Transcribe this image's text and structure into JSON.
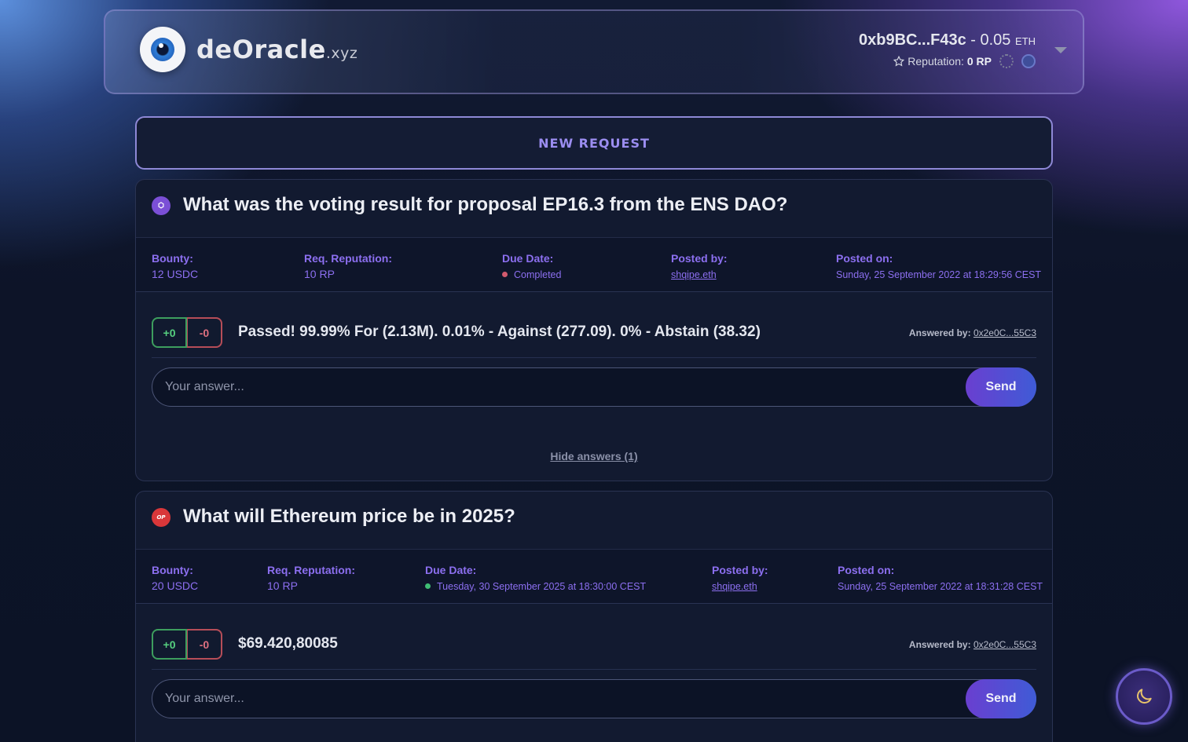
{
  "brand": {
    "name": "deOracle",
    "tld": ".xyz"
  },
  "account": {
    "address": "0xb9BC...F43c",
    "separator": " - ",
    "balance": "0.05",
    "unit": "ETH",
    "reputation_label": "Reputation:",
    "reputation_value": "0 RP"
  },
  "new_request_label": "NEW REQUEST",
  "requests": [
    {
      "chain_icon": "polygon-icon",
      "title": "What was the voting result for proposal EP16.3 from the ENS DAO?",
      "bounty_label": "Bounty:",
      "bounty": "12 USDC",
      "rep_label": "Req. Reputation:",
      "rep": "10 RP",
      "due_label": "Due Date:",
      "due": "Completed",
      "due_status": "red",
      "posted_by_label": "Posted by:",
      "posted_by": "shqipe.eth",
      "posted_on_label": "Posted on:",
      "posted_on": "Sunday, 25 September 2022 at 18:29:56 CEST",
      "answer": {
        "up": "+0",
        "down": "-0",
        "text": "Passed! 99.99% For (2.13M). 0.01% - Against (277.09). 0% - Abstain (38.32)",
        "by_label": "Answered by:",
        "by": "0x2e0C...55C3"
      },
      "input_placeholder": "Your answer...",
      "send_label": "Send",
      "hide_label": "Hide answers (1)"
    },
    {
      "chain_icon": "optimism-icon",
      "chain_text": "OP",
      "title": "What will Ethereum price be in 2025?",
      "bounty_label": "Bounty:",
      "bounty": "20 USDC",
      "rep_label": "Req. Reputation:",
      "rep": "10 RP",
      "due_label": "Due Date:",
      "due": "Tuesday, 30 September 2025 at 18:30:00 CEST",
      "due_status": "green",
      "posted_by_label": "Posted by:",
      "posted_by": "shqipe.eth",
      "posted_on_label": "Posted on:",
      "posted_on": "Sunday, 25 September 2022 at 18:31:28 CEST",
      "answer": {
        "up": "+0",
        "down": "-0",
        "text": "$69.420,80085",
        "by_label": "Answered by:",
        "by": "0x2e0C...55C3"
      },
      "input_placeholder": "Your answer...",
      "send_label": "Send"
    }
  ],
  "colors": {
    "accent": "#8c6ff0",
    "up": "#56d07f",
    "down": "#e07080",
    "completed": "#d25a6e",
    "open": "#3fbd74"
  },
  "theme_toggle_icon": "moon-icon"
}
